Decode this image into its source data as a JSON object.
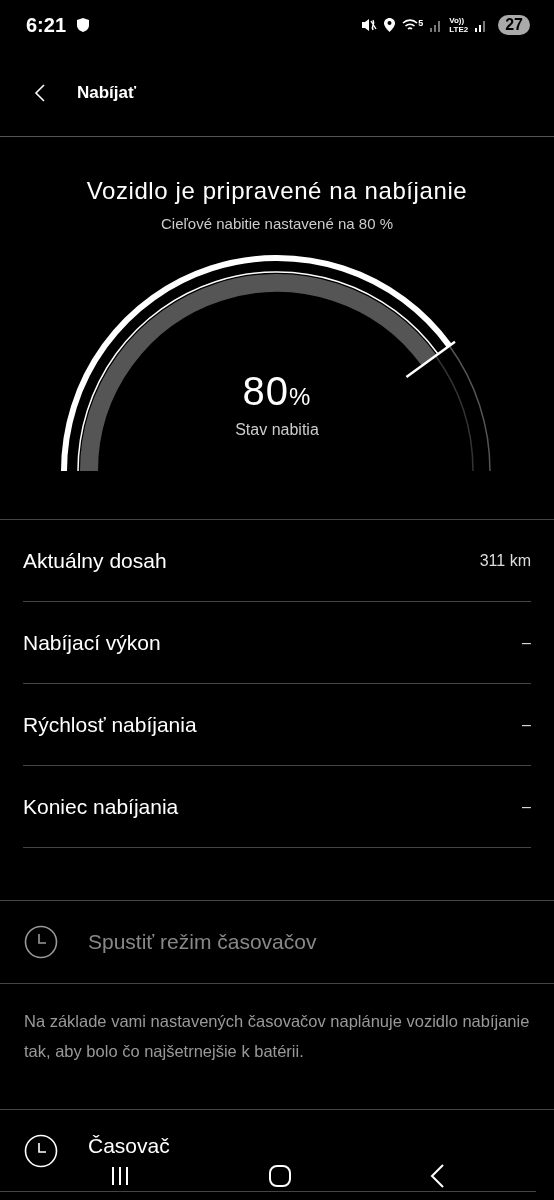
{
  "status_bar": {
    "time": "6:21",
    "network_label_top": "Vo))",
    "network_label_bottom": "LTE2",
    "wifi_label": "5",
    "battery": "27"
  },
  "header": {
    "title": "Nabíjať"
  },
  "hero": {
    "title": "Vozidlo je pripravené na nabíjanie",
    "subtitle": "Cieľové nabitie nastavené na 80 %"
  },
  "gauge": {
    "value": "80",
    "unit": "%",
    "label": "Stav nabitia"
  },
  "stats": [
    {
      "label": "Aktuálny dosah",
      "value": "311 km"
    },
    {
      "label": "Nabíjací výkon",
      "value": "–"
    },
    {
      "label": "Rýchlosť nabíjania",
      "value": "–"
    },
    {
      "label": "Koniec nabíjania",
      "value": "–"
    }
  ],
  "timer_mode": {
    "label": "Spustiť režim časovačov",
    "disabled": true,
    "description": "Na základe vami nastavených časovačov naplánuje vozidlo nabíjanie tak, aby bolo čo najšetrnejšie k batérii."
  },
  "timer": {
    "label": "Časovač",
    "disabled": false
  }
}
